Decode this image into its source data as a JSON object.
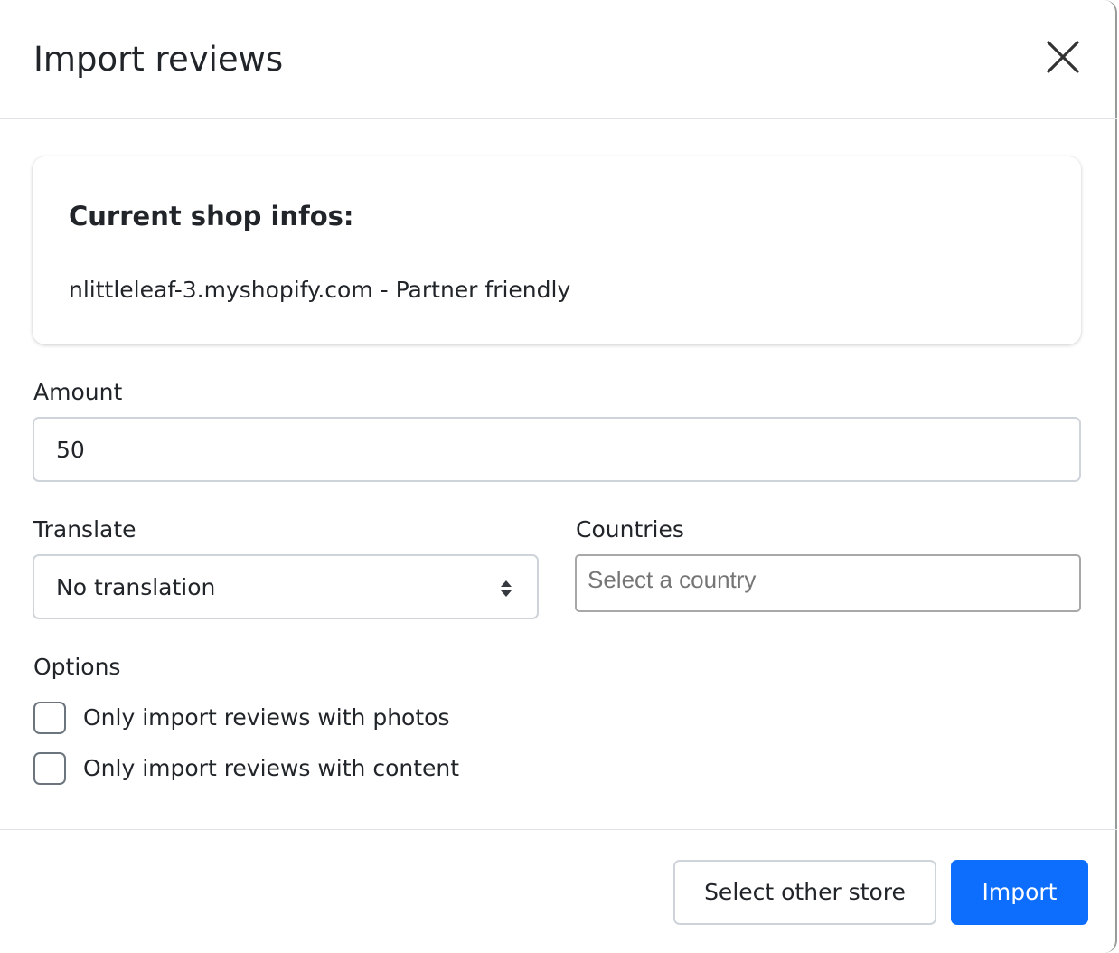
{
  "modal": {
    "title": "Import reviews"
  },
  "shop_info": {
    "heading": "Current shop infos:",
    "details": "nlittleleaf-3.myshopify.com - Partner friendly"
  },
  "amount": {
    "label": "Amount",
    "value": "50"
  },
  "translate": {
    "label": "Translate",
    "selected": "No translation"
  },
  "countries": {
    "label": "Countries",
    "placeholder": "Select a country",
    "value": ""
  },
  "options": {
    "label": "Options",
    "items": [
      {
        "label": "Only import reviews with photos",
        "checked": false
      },
      {
        "label": "Only import reviews with content",
        "checked": false
      }
    ]
  },
  "footer": {
    "secondary_label": "Select other store",
    "primary_label": "Import"
  },
  "colors": {
    "primary": "#0d6efd",
    "border": "#ced4da",
    "text": "#212529"
  },
  "icons": {
    "close": "close-icon",
    "select": "sort-arrows-icon"
  }
}
